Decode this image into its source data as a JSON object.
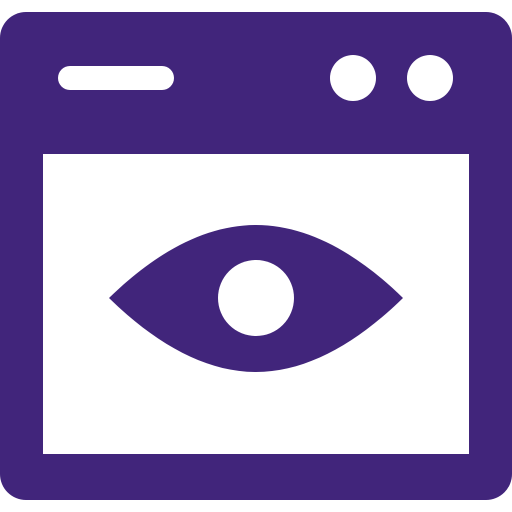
{
  "icon": {
    "name": "browser-window-with-eye",
    "primary_color": "#41257b",
    "background_color": "#ffffff"
  },
  "parts": {
    "window_frame": "browser-window-icon",
    "address_bar": "address-bar-pill",
    "controls": [
      "window-control-dot",
      "window-control-dot"
    ],
    "content_area": "content-panel",
    "eye": "eye-icon",
    "pupil": "pupil-dot"
  }
}
